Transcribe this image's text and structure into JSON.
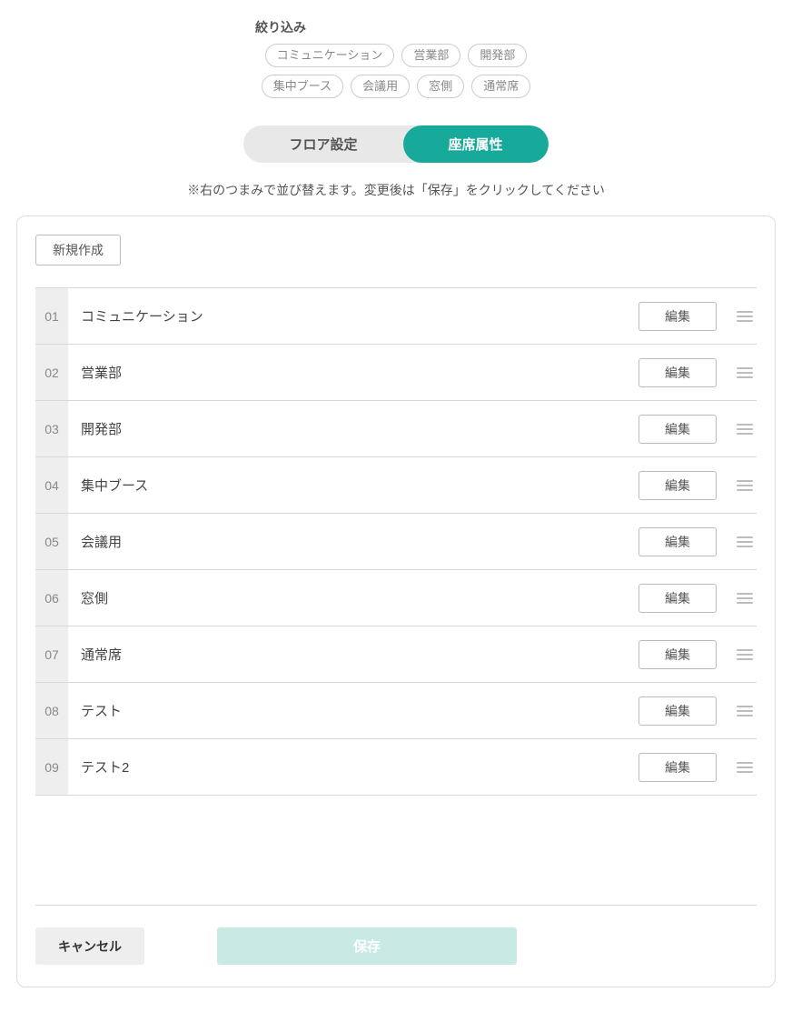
{
  "filter": {
    "label": "絞り込み",
    "chips": [
      "コミュニケーション",
      "営業部",
      "開発部",
      "集中ブース",
      "会議用",
      "窓側",
      "通常席"
    ]
  },
  "tabs": {
    "floor": "フロア設定",
    "seat": "座席属性"
  },
  "instruction": "※右のつまみで並び替えます。変更後は「保存」をクリックしてください",
  "buttons": {
    "new": "新規作成",
    "edit": "編集",
    "cancel": "キャンセル",
    "save": "保存"
  },
  "rows": [
    {
      "num": "01",
      "label": "コミュニケーション"
    },
    {
      "num": "02",
      "label": "営業部"
    },
    {
      "num": "03",
      "label": "開発部"
    },
    {
      "num": "04",
      "label": "集中ブース"
    },
    {
      "num": "05",
      "label": "会議用"
    },
    {
      "num": "06",
      "label": "窓側"
    },
    {
      "num": "07",
      "label": "通常席"
    },
    {
      "num": "08",
      "label": "テスト"
    },
    {
      "num": "09",
      "label": "テスト2"
    }
  ]
}
